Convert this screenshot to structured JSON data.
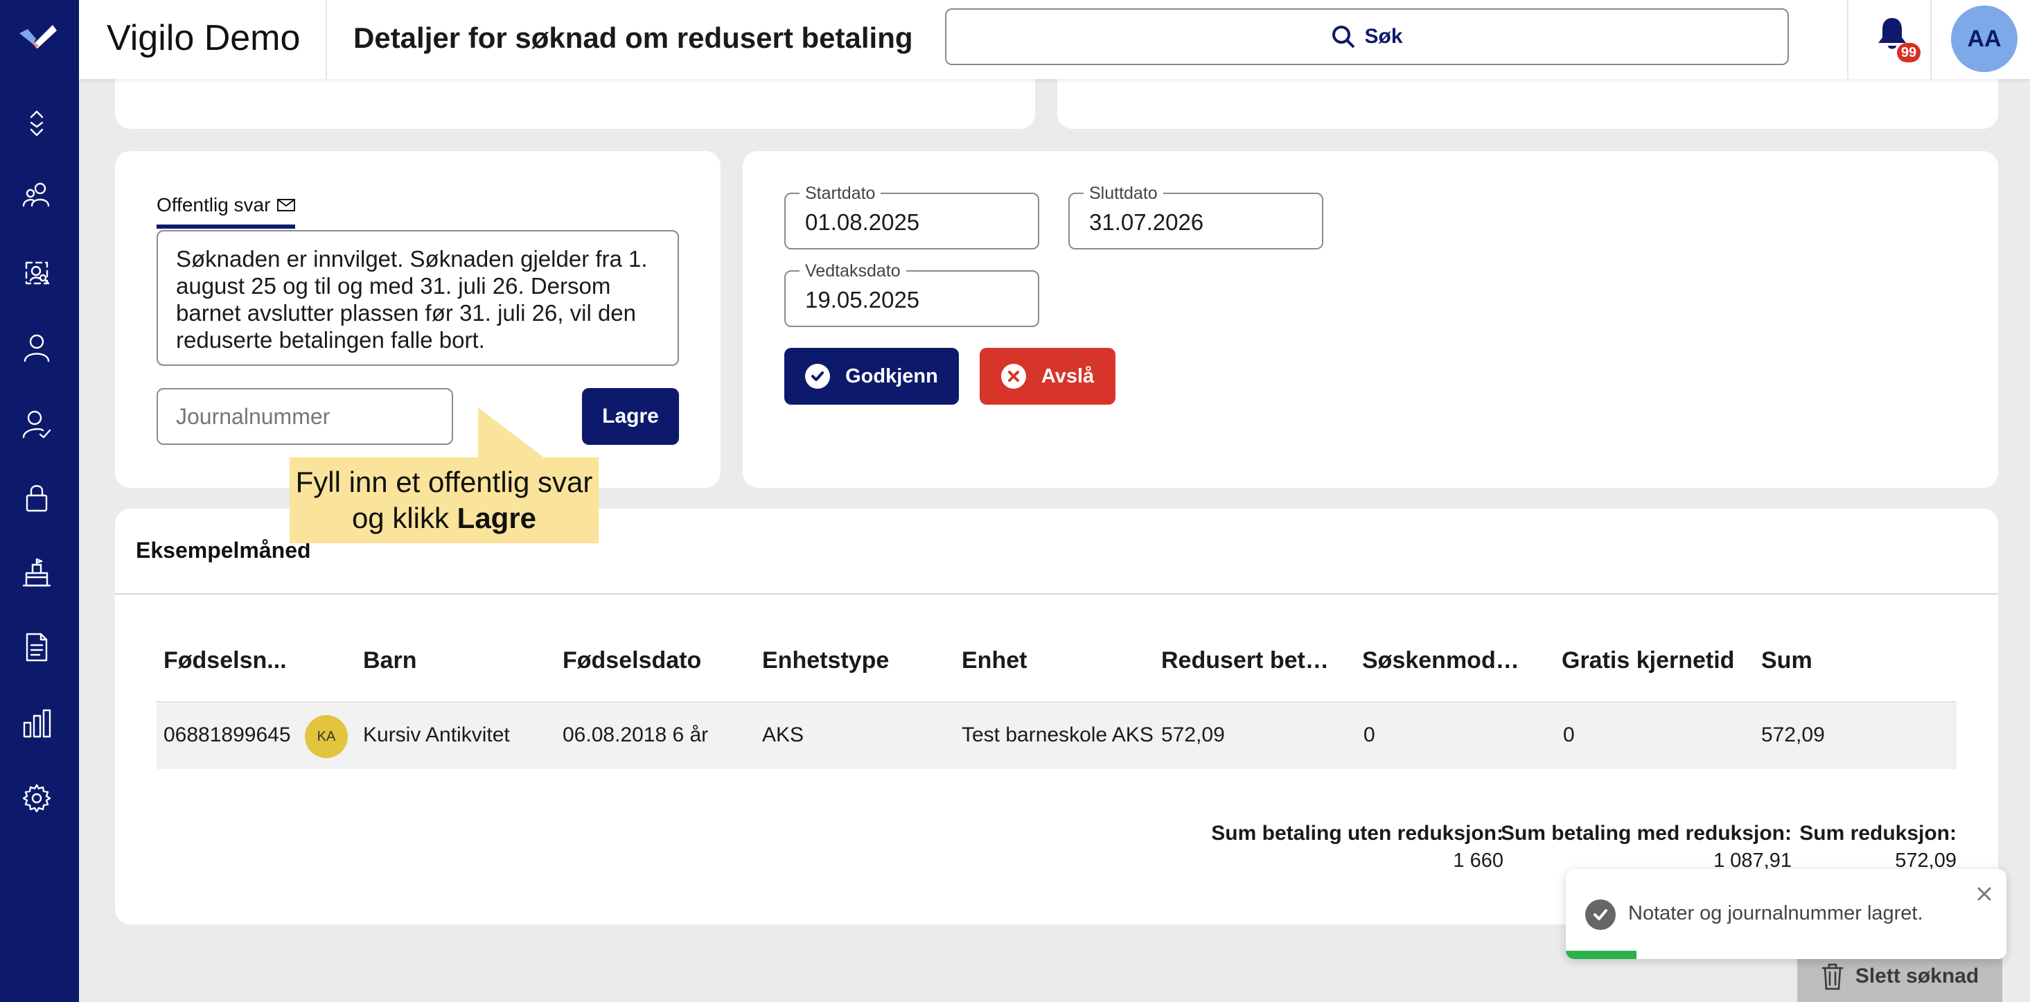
{
  "app": {
    "name": "Vigilo Demo"
  },
  "page": {
    "title": "Detaljer for søknad om redusert betaling"
  },
  "search": {
    "label": "Søk"
  },
  "notifications": {
    "badge": "99"
  },
  "user": {
    "initials": "AA"
  },
  "sidebar": {
    "items": [
      {
        "icon": "expand-collapse-icon"
      },
      {
        "icon": "users-icon"
      },
      {
        "icon": "user-search-icon"
      },
      {
        "icon": "person-icon"
      },
      {
        "icon": "person-check-icon"
      },
      {
        "icon": "lock-icon"
      },
      {
        "icon": "institution-icon"
      },
      {
        "icon": "document-icon"
      },
      {
        "icon": "bar-chart-icon"
      },
      {
        "icon": "settings-icon"
      }
    ]
  },
  "reply": {
    "tab_label": "Offentlig svar",
    "text": "Søknaden er innvilget. Søknaden gjelder fra 1. august 25 og til og med 31. juli 26. Dersom barnet avslutter plassen før 31. juli 26, vil den reduserte betalingen falle bort.",
    "journal_placeholder": "Journalnummer",
    "journal_value": "",
    "save_label": "Lagre"
  },
  "tooltip": {
    "text": "Fyll inn et offentlig svar og klikk",
    "emphasis": "Lagre"
  },
  "dates": {
    "start": {
      "label": "Startdato",
      "value": "01.08.2025"
    },
    "end": {
      "label": "Sluttdato",
      "value": "31.07.2026"
    },
    "decision": {
      "label": "Vedtaksdato",
      "value": "19.05.2025"
    },
    "approve_label": "Godkjenn",
    "reject_label": "Avslå"
  },
  "example": {
    "title": "Eksempelmåned",
    "columns": [
      "Fødselsn...",
      "Barn",
      "Fødselsdato",
      "Enhetstype",
      "Enhet",
      "Redusert beta...",
      "Søskenmoder...",
      "Gratis kjernetid",
      "Sum"
    ],
    "row": {
      "birth_number": "06881899645",
      "initials": "KA",
      "child": "Kursiv Antikvitet",
      "birth_date": "06.08.2018 6 år",
      "unit_type": "AKS",
      "unit": "Test barneskole AKS",
      "reduced_payment": "572,09",
      "sibling": "0",
      "free_core_time": "0",
      "sum": "572,09"
    },
    "totals": {
      "without_label": "Sum betaling uten reduksjon:",
      "without_value": "1 660",
      "with_label": "Sum betaling med reduksjon:",
      "with_value": "1 087,91",
      "reduction_label": "Sum reduksjon:",
      "reduction_value": "572,09"
    }
  },
  "toast": {
    "message": "Notater og journalnummer lagret.",
    "progress_pct": 16
  },
  "delete": {
    "label": "Slett søknad"
  },
  "colors": {
    "brand": "#0d1a6b",
    "danger": "#d8352a",
    "tooltip": "#fae39a",
    "success": "#2bb24c"
  }
}
